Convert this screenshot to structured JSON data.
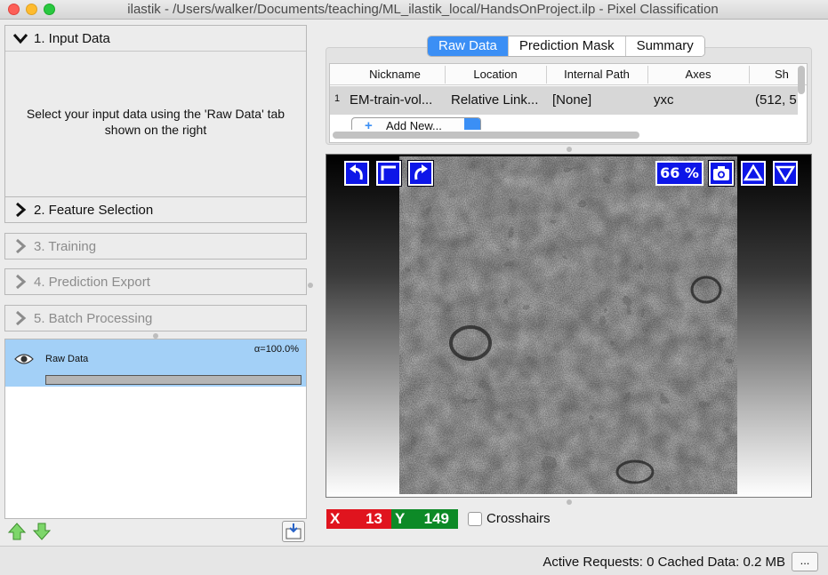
{
  "window": {
    "title": "ilastik - /Users/walker/Documents/teaching/ML_ilastik_local/HandsOnProject.ilp - Pixel Classification"
  },
  "applets": [
    {
      "label": "1. Input Data",
      "expanded": true,
      "enabled": true
    },
    {
      "label": "2. Feature Selection",
      "expanded": false,
      "enabled": true
    },
    {
      "label": "3. Training",
      "expanded": false,
      "enabled": false
    },
    {
      "label": "4. Prediction Export",
      "expanded": false,
      "enabled": false
    },
    {
      "label": "5. Batch Processing",
      "expanded": false,
      "enabled": false
    }
  ],
  "input_data_instructions": "Select your input data using the 'Raw Data' tab shown on the right",
  "layers": [
    {
      "name": "Raw Data",
      "opacity": "α=100.0%",
      "visible": true,
      "selected": true
    }
  ],
  "tabs": [
    {
      "label": "Raw Data",
      "active": true
    },
    {
      "label": "Prediction Mask",
      "active": false
    },
    {
      "label": "Summary",
      "active": false
    }
  ],
  "dataset_table": {
    "columns": [
      "Nickname",
      "Location",
      "Internal Path",
      "Axes",
      "Sh"
    ],
    "rows": [
      {
        "index": "1",
        "cells": [
          "EM-train-vol...",
          "Relative Link...",
          "[None]",
          "yxc",
          "(512, 5"
        ]
      }
    ],
    "add_new_label": "Add New..."
  },
  "viewer": {
    "zoom": "66 %",
    "buttons": [
      "rotate-left-icon",
      "swap-axes-icon",
      "rotate-right-icon",
      "camera-icon",
      "triangle-up-icon",
      "triangle-down-icon"
    ]
  },
  "coordinates": {
    "x_label": "X",
    "x": "13",
    "y_label": "Y",
    "y": "149"
  },
  "crosshairs_label": "Crosshairs",
  "status": {
    "text": "Active Requests: 0  Cached Data: 0.2 MB",
    "more_button": "..."
  },
  "colors": {
    "accent": "#3b8ff5",
    "viewer_button": "#0d16e8",
    "x_badge": "#e0141e",
    "y_badge": "#0d8a27",
    "layer_selected": "#a3d0f7"
  }
}
